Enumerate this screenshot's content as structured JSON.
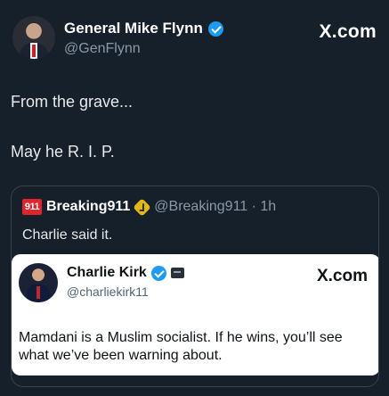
{
  "post": {
    "display_name": "General Mike Flynn",
    "handle": "@GenFlynn",
    "brand": "X.com",
    "text_line1": "From the grave...",
    "text_line2": "May he R. I. P."
  },
  "quoted_post": {
    "logo_text": "911",
    "display_name": "Breaking911",
    "handle_time": "@Breaking911 · 1h",
    "text": "Charlie said it."
  },
  "embedded_post": {
    "display_name": "Charlie Kirk",
    "handle": "@charliekirk11",
    "brand": "X.com",
    "text": "Mamdani is a Muslim socialist. If he wins, you’ll see what we’ve been warning about."
  },
  "colors": {
    "background": "#15202b",
    "verified_blue": "#1d9bf0",
    "verified_gold": "#e2b719",
    "logo_red": "#e0242b"
  },
  "icons": [
    "verified-badge-icon",
    "gold-verified-badge-icon",
    "affiliate-badge-icon",
    "breaking911-logo"
  ]
}
